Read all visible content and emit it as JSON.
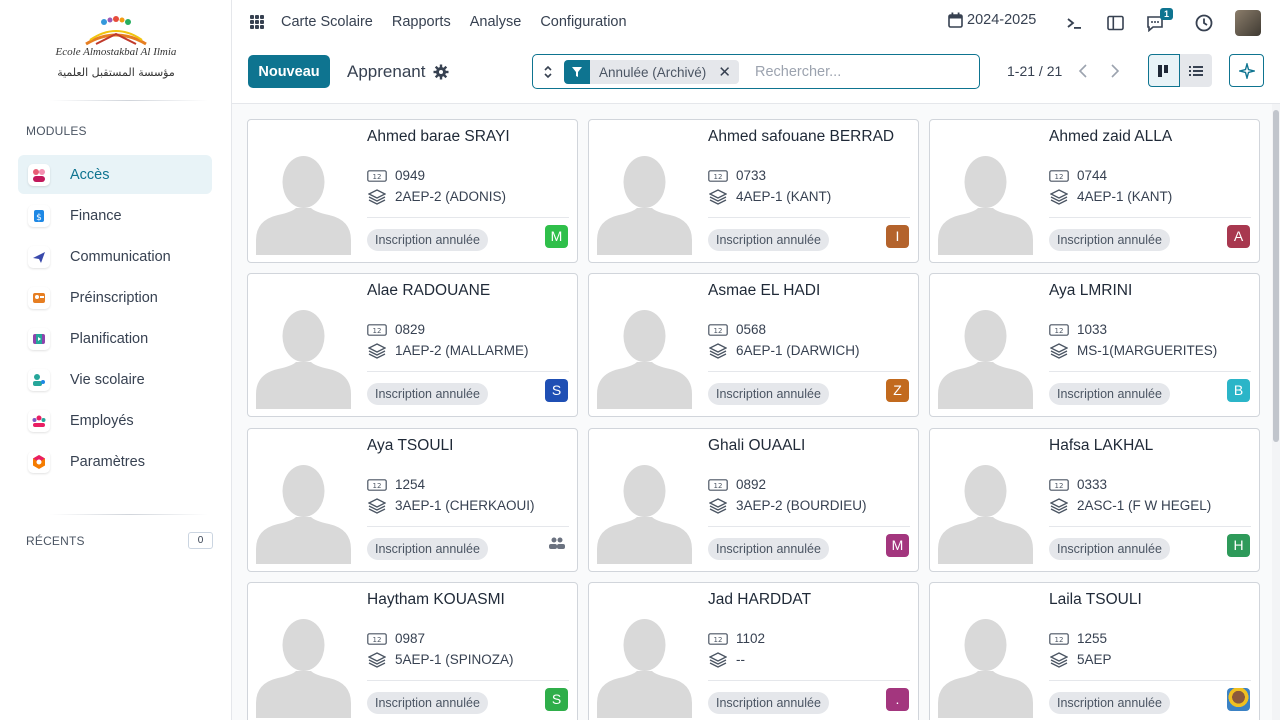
{
  "sidebar": {
    "logo_line1": "Ecole Almostakbal Al Ilmia",
    "logo_line2": "مؤسسة المستقبل العلمية",
    "modules_title": "MODULES",
    "recents_title": "RÉCENTS",
    "recents_count": "0",
    "items": [
      {
        "label": "Accès",
        "icon": "access-icon",
        "color": "#e85d75"
      },
      {
        "label": "Finance",
        "icon": "finance-icon",
        "color": "#1e88e5"
      },
      {
        "label": "Communication",
        "icon": "communication-icon",
        "color": "#3949ab"
      },
      {
        "label": "Préinscription",
        "icon": "preinscription-icon",
        "color": "#e67e22"
      },
      {
        "label": "Planification",
        "icon": "planification-icon",
        "color": "#8e44ad"
      },
      {
        "label": "Vie scolaire",
        "icon": "school-life-icon",
        "color": "#26a69a"
      },
      {
        "label": "Employés",
        "icon": "employees-icon",
        "color": "#e91e63"
      },
      {
        "label": "Paramètres",
        "icon": "settings-icon",
        "color": "#f57c00"
      }
    ]
  },
  "topbar": {
    "menu": [
      "Carte Scolaire",
      "Rapports",
      "Analyse",
      "Configuration"
    ],
    "year": "2024-2025",
    "messages_badge": "1"
  },
  "controlbar": {
    "new_label": "Nouveau",
    "breadcrumb": "Apprenant",
    "facet_label": "Annulée (Archivé)",
    "search_placeholder": "Rechercher...",
    "pager": "1-21 / 21"
  },
  "cards": [
    {
      "name": "Ahmed barae SRAYI",
      "code": "0949",
      "class": "2AEP-2 (ADONIS)",
      "status": "Inscription annulée",
      "owner": "M",
      "owner_color": "#2fbf4a"
    },
    {
      "name": "Ahmed safouane BERRAD",
      "code": "0733",
      "class": "4AEP-1 (KANT)",
      "status": "Inscription annulée",
      "owner": "I",
      "owner_color": "#b4632c"
    },
    {
      "name": "Ahmed zaid ALLA",
      "code": "0744",
      "class": "4AEP-1 (KANT)",
      "status": "Inscription annulée",
      "owner": "A",
      "owner_color": "#a8384f"
    },
    {
      "name": "Alae RADOUANE",
      "code": "0829",
      "class": "1AEP-2 (MALLARME)",
      "status": "Inscription annulée",
      "owner": "S",
      "owner_color": "#1f4fb4"
    },
    {
      "name": "Asmae EL HADI",
      "code": "0568",
      "class": "6AEP-1 (DARWICH)",
      "status": "Inscription annulée",
      "owner": "Z",
      "owner_color": "#c26a1e"
    },
    {
      "name": "Aya LMRINI",
      "code": "1033",
      "class": "MS-1(MARGUERITES)",
      "status": "Inscription annulée",
      "owner": "B",
      "owner_color": "#2bb5c8"
    },
    {
      "name": "Aya TSOULI",
      "code": "1254",
      "class": "3AEP-1 (CHERKAOUI)",
      "status": "Inscription annulée",
      "owner": "",
      "owner_color": ""
    },
    {
      "name": "Ghali OUAALI",
      "code": "0892",
      "class": "3AEP-2 (BOURDIEU)",
      "status": "Inscription annulée",
      "owner": "M",
      "owner_color": "#a3367e"
    },
    {
      "name": "Hafsa LAKHAL",
      "code": "0333",
      "class": "2ASC-1 (F W HEGEL)",
      "status": "Inscription annulée",
      "owner": "H",
      "owner_color": "#2e9a5a"
    },
    {
      "name": "Haytham KOUASMI",
      "code": "0987",
      "class": "5AEP-1 (SPINOZA)",
      "status": "Inscription annulée",
      "owner": "S",
      "owner_color": "#2fae4a"
    },
    {
      "name": "Jad HARDDAT",
      "code": "1102",
      "class": "--",
      "status": "Inscription annulée",
      "owner": ".",
      "owner_color": "#a3367e"
    },
    {
      "name": "Laila TSOULI",
      "code": "1255",
      "class": "5AEP",
      "status": "Inscription annulée",
      "owner": "",
      "owner_color": ""
    }
  ]
}
